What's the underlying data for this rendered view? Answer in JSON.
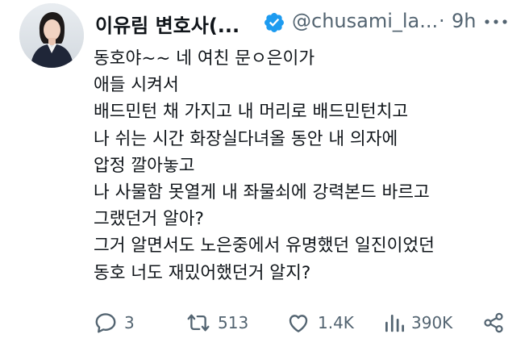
{
  "tweet": {
    "author": {
      "display_name": "이유림 변호사(...",
      "handle": "@chusami_la...",
      "verified": true
    },
    "separator": "·",
    "time": "9h",
    "body_lines": [
      "동호야~~ 네 여친 문ㅇ은이가",
      "애들 시켜서",
      "배드민턴 채 가지고 내 머리로 배드민턴치고",
      "나 쉬는 시간 화장실다녀올 동안 내 의자에",
      "압정 깔아놓고",
      "나 사물함 못열게 내 좌물쇠에 강력본드 바르고",
      "그랬던거 알아?",
      "그거 알면서도 노은중에서 유명했던 일진이었던",
      "동호 너도 재밌어했던거 알지?"
    ],
    "actions": {
      "replies": "3",
      "retweets": "513",
      "likes": "1.4K",
      "views": "390K"
    }
  },
  "colors": {
    "text": "#0f1419",
    "secondary": "#536471",
    "verified": "#1d9bf0",
    "background": "#ffffff"
  },
  "icons": {
    "verified": "verified-badge-icon",
    "more": "more-dots-icon",
    "reply": "reply-icon",
    "retweet": "retweet-icon",
    "like": "heart-icon",
    "views": "views-chart-icon",
    "share": "share-icon"
  }
}
